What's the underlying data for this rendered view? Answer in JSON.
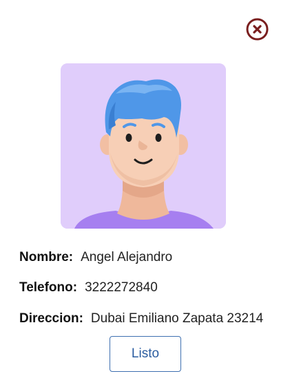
{
  "icons": {
    "close": "close-circle-x-icon",
    "close_color": "#7a1f1f"
  },
  "profile": {
    "avatar": "user-avatar-3d-illustration",
    "avatar_background": "#e0cdfb",
    "fields": [
      {
        "label": "Nombre:",
        "value": "Angel Alejandro"
      },
      {
        "label": "Telefono:",
        "value": "3222272840"
      },
      {
        "label": "Direccion:",
        "value": "Dubai Emiliano Zapata 23214"
      }
    ]
  },
  "actions": {
    "done_label": "Listo",
    "done_color": "#2a5ca0"
  }
}
